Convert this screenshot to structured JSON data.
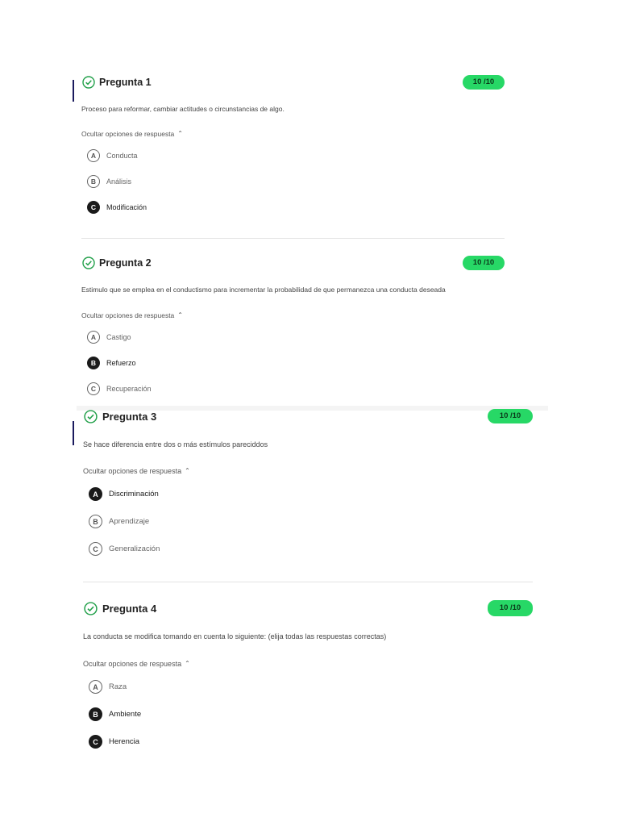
{
  "questions": [
    {
      "title": "Pregunta 1",
      "score": "10 /10",
      "text": "Proceso para reformar, cambiar actitudes o circunstancias de algo.",
      "toggle": "Ocultar opciones de respuesta",
      "options": [
        {
          "letter": "A",
          "label": "Conducta",
          "selected": false
        },
        {
          "letter": "B",
          "label": "Análisis",
          "selected": false
        },
        {
          "letter": "C",
          "label": "Modificación",
          "selected": true
        }
      ]
    },
    {
      "title": "Pregunta 2",
      "score": "10 /10",
      "text": "Estimulo que se emplea en el conductismo para incrementar la probabilidad de que permanezca una conducta deseada",
      "toggle": "Ocultar opciones de respuesta",
      "options": [
        {
          "letter": "A",
          "label": "Castigo",
          "selected": false
        },
        {
          "letter": "B",
          "label": "Refuerzo",
          "selected": true
        },
        {
          "letter": "C",
          "label": "Recuperación",
          "selected": false
        }
      ]
    },
    {
      "title": "Pregunta 3",
      "score": "10 /10",
      "text": "Se hace diferencia entre dos o más estímulos pareciddos",
      "toggle": "Ocultar opciones de respuesta",
      "options": [
        {
          "letter": "A",
          "label": "Discriminación",
          "selected": true
        },
        {
          "letter": "B",
          "label": "Aprendizaje",
          "selected": false
        },
        {
          "letter": "C",
          "label": "Generalización",
          "selected": false
        }
      ]
    },
    {
      "title": "Pregunta 4",
      "score": "10 /10",
      "text": "La conducta se modifica tomando en cuenta lo siguiente: (elija todas las respuestas correctas)",
      "toggle": "Ocultar opciones de respuesta",
      "options": [
        {
          "letter": "A",
          "label": "Raza",
          "selected": false
        },
        {
          "letter": "B",
          "label": "Ambiente",
          "selected": true
        },
        {
          "letter": "C",
          "label": "Herencia",
          "selected": true
        }
      ]
    }
  ],
  "colors": {
    "score_badge": "#27d866",
    "check": "#22a04a",
    "accent_bar": "#1a1a5e",
    "selected_option": "#1a1a1a"
  },
  "icons": {
    "check": "check-circle-icon",
    "chevron": "chevron-up-icon"
  }
}
